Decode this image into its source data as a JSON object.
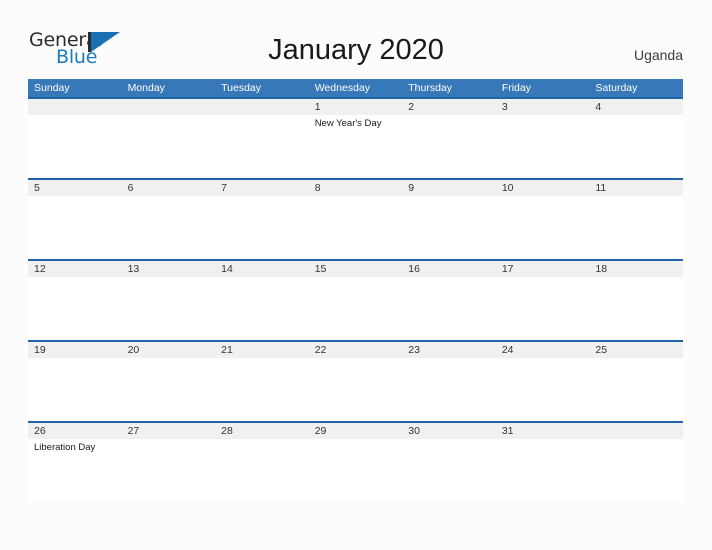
{
  "brand": {
    "name_part1": "General",
    "name_part2": "Blue",
    "mark": "triangle-logo-icon",
    "colors": {
      "dark": "#2b2b2b",
      "blue": "#1b7bc0"
    }
  },
  "header": {
    "title": "January 2020",
    "locale": "Uganda"
  },
  "calendar": {
    "month": "January",
    "year": "2020",
    "colors": {
      "header_blue": "#3778b9",
      "row_rule_blue": "#1f63a9",
      "date_band_gray": "#f0f0f0",
      "page_background": "#fcfcfc"
    },
    "weekday_headers": [
      "Sunday",
      "Monday",
      "Tuesday",
      "Wednesday",
      "Thursday",
      "Friday",
      "Saturday"
    ],
    "weeks": [
      [
        {
          "date": "",
          "event": ""
        },
        {
          "date": "",
          "event": ""
        },
        {
          "date": "",
          "event": ""
        },
        {
          "date": "1",
          "event": "New Year's Day"
        },
        {
          "date": "2",
          "event": ""
        },
        {
          "date": "3",
          "event": ""
        },
        {
          "date": "4",
          "event": ""
        }
      ],
      [
        {
          "date": "5",
          "event": ""
        },
        {
          "date": "6",
          "event": ""
        },
        {
          "date": "7",
          "event": ""
        },
        {
          "date": "8",
          "event": ""
        },
        {
          "date": "9",
          "event": ""
        },
        {
          "date": "10",
          "event": ""
        },
        {
          "date": "11",
          "event": ""
        }
      ],
      [
        {
          "date": "12",
          "event": ""
        },
        {
          "date": "13",
          "event": ""
        },
        {
          "date": "14",
          "event": ""
        },
        {
          "date": "15",
          "event": ""
        },
        {
          "date": "16",
          "event": ""
        },
        {
          "date": "17",
          "event": ""
        },
        {
          "date": "18",
          "event": ""
        }
      ],
      [
        {
          "date": "19",
          "event": ""
        },
        {
          "date": "20",
          "event": ""
        },
        {
          "date": "21",
          "event": ""
        },
        {
          "date": "22",
          "event": ""
        },
        {
          "date": "23",
          "event": ""
        },
        {
          "date": "24",
          "event": ""
        },
        {
          "date": "25",
          "event": ""
        }
      ],
      [
        {
          "date": "26",
          "event": "Liberation Day"
        },
        {
          "date": "27",
          "event": ""
        },
        {
          "date": "28",
          "event": ""
        },
        {
          "date": "29",
          "event": ""
        },
        {
          "date": "30",
          "event": ""
        },
        {
          "date": "31",
          "event": ""
        },
        {
          "date": "",
          "event": ""
        }
      ]
    ]
  }
}
